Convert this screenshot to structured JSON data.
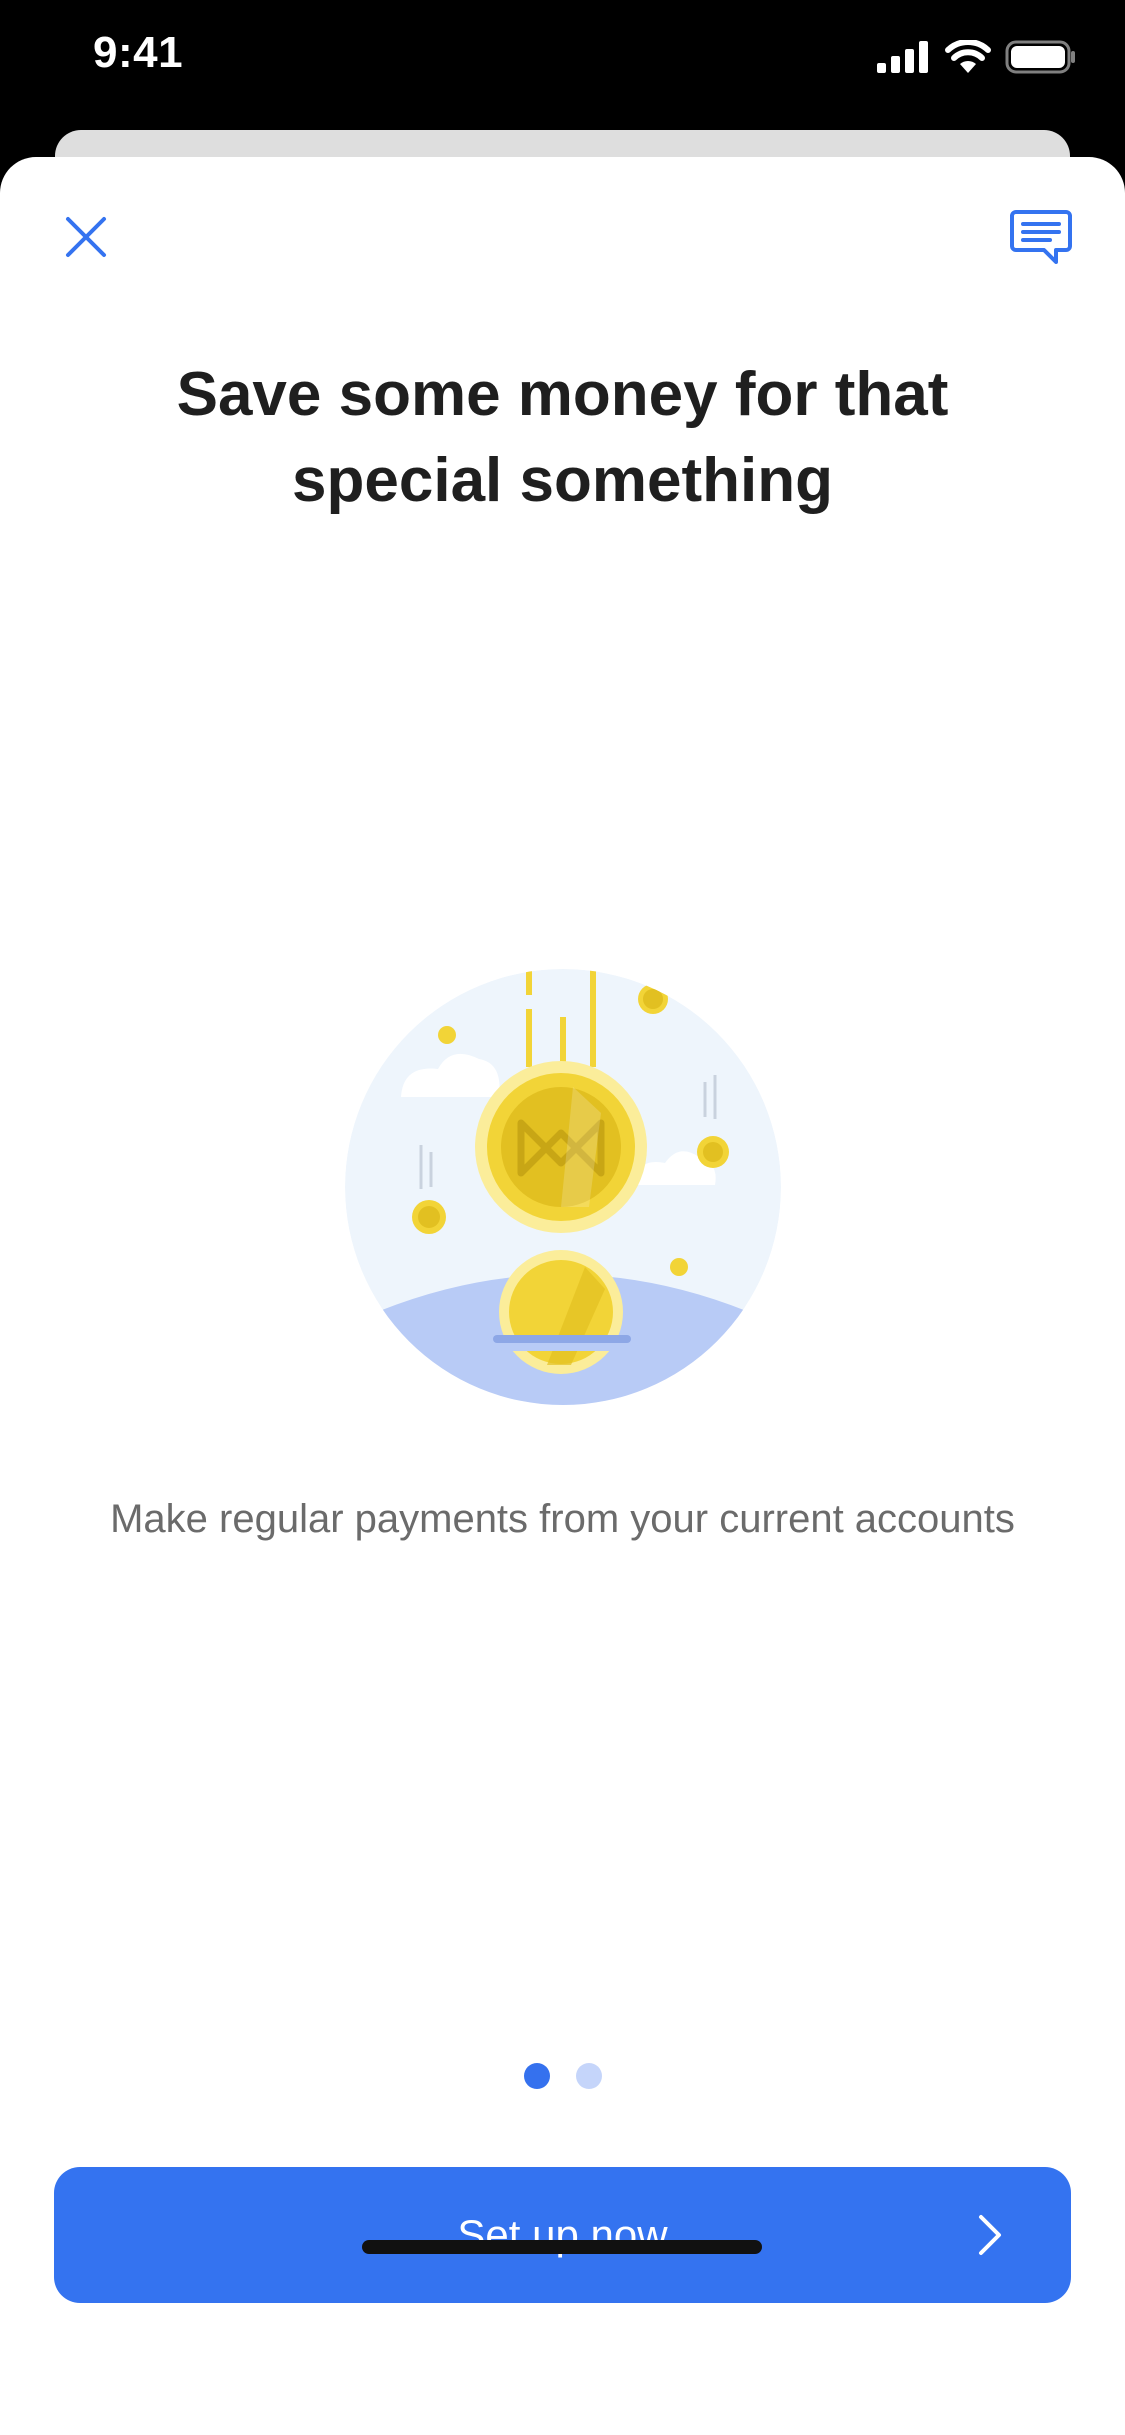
{
  "status_bar": {
    "time": "9:41",
    "icons": [
      "cellular-signal-icon",
      "wifi-icon",
      "battery-icon"
    ]
  },
  "header": {
    "close_icon": "close-icon",
    "chat_icon": "chat-icon"
  },
  "main": {
    "title": "Save some money for that special something",
    "illustration": "savings-coins-illustration",
    "subtitle": "Make regular payments from your current accounts"
  },
  "pager": {
    "page_count": 2,
    "active_page": 1
  },
  "cta": {
    "label": "Set up now",
    "icon": "chevron-right-icon"
  },
  "colors": {
    "accent": "#3473F0",
    "title": "#1F1F1F",
    "subtitle": "#6B6B6B",
    "coin": "#F2D437",
    "hill": "#B8CBF6"
  }
}
